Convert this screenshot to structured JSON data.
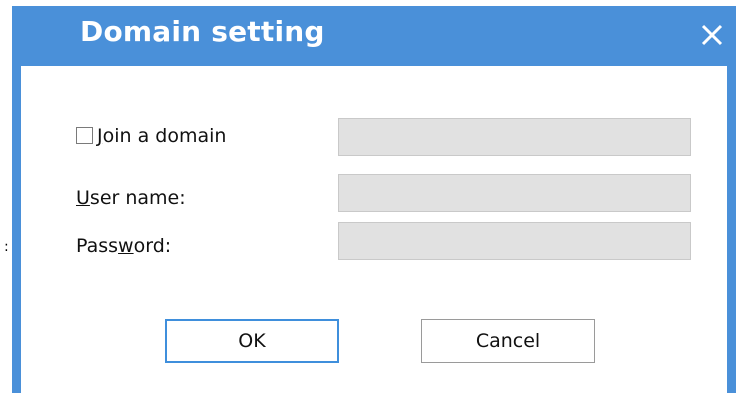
{
  "window": {
    "title": "Domain setting",
    "close_icon": "close-icon",
    "accent_color": "#4a90d9"
  },
  "form": {
    "join_domain": {
      "label_prefix": "",
      "label_mnemonic": "J",
      "label_rest": "oin a domain",
      "checked": false,
      "value": ""
    },
    "user_name": {
      "label_mnemonic": "U",
      "label_rest": "ser name:",
      "value": ""
    },
    "password": {
      "label_before": "Pass",
      "label_mnemonic": "w",
      "label_after": "ord:",
      "value": ""
    }
  },
  "buttons": {
    "ok": "OK",
    "cancel": "Cancel"
  },
  "stray_mark": ":"
}
